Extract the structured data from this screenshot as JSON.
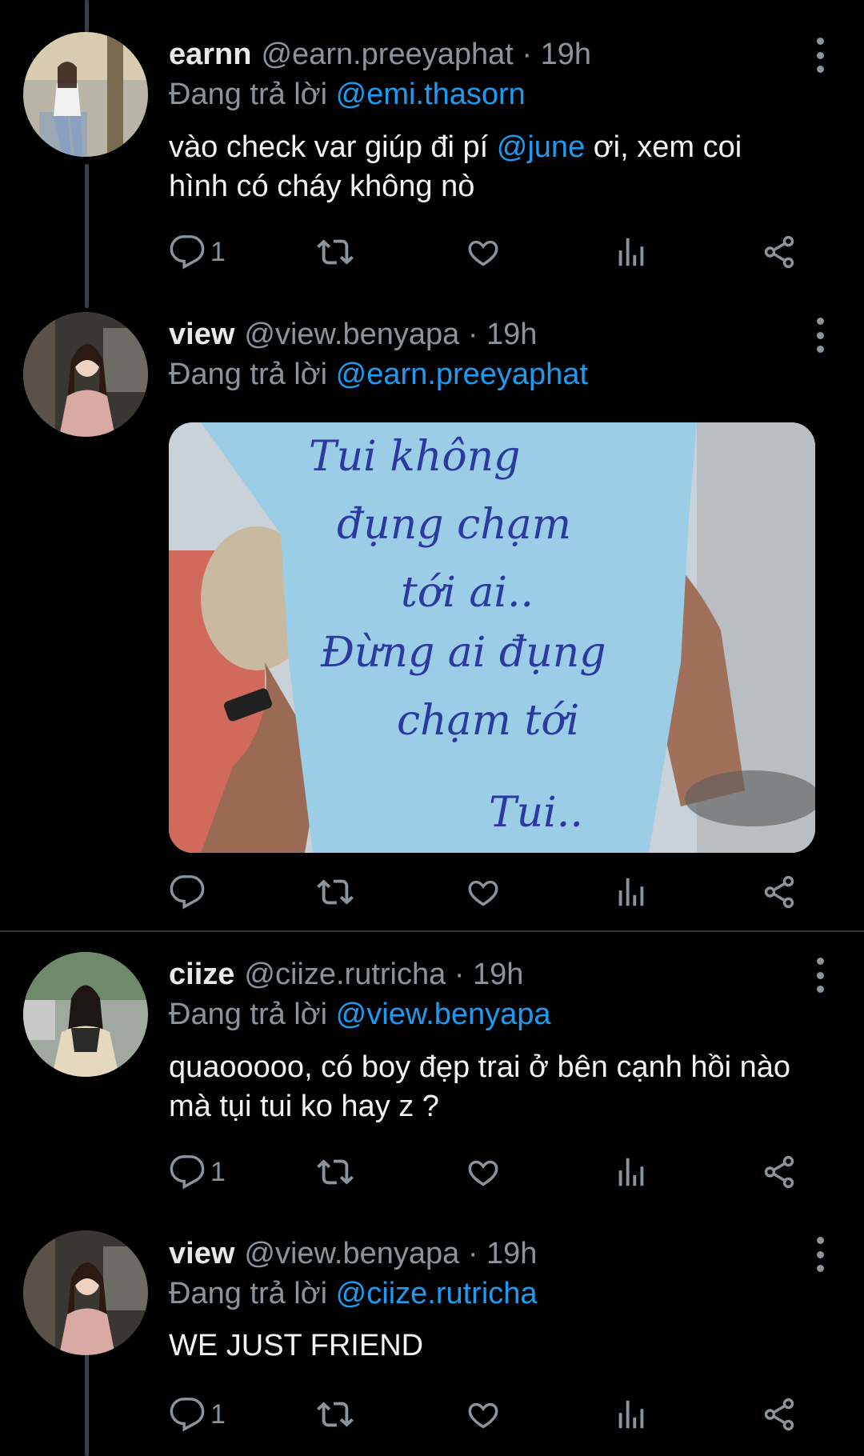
{
  "colors": {
    "background": "#000000",
    "text": "#e7e9ea",
    "secondary": "#8b939b",
    "accent": "#1d9bf0"
  },
  "tweets": [
    {
      "display_name": "earnn",
      "handle": "@earn.preeyaphat",
      "time": "· 19h",
      "replying_label": "Đang trả lời",
      "replying_to": "@emi.thasorn",
      "text_before": "vào check var giúp đi pí ",
      "text_mention": "@june",
      "text_after": " ơi, xem coi hình có cháy không nò",
      "reply_count": "1"
    },
    {
      "display_name": "view",
      "handle": "@view.benyapa",
      "time": "· 19h",
      "replying_label": "Đang trả lời",
      "replying_to": "@earn.preeyaphat",
      "media": {
        "description_icon": "photo-of-handwritten-shirt",
        "handwriting_lines": [
          "Tui không",
          "đụng chạm",
          "tới ai..",
          "Đừng ai đụng",
          "chạm tới",
          "Tui.."
        ]
      },
      "reply_count": ""
    },
    {
      "display_name": "ciize",
      "handle": "@ciize.rutricha",
      "time": "· 19h",
      "replying_label": "Đang trả lời",
      "replying_to": "@view.benyapa",
      "text": "quaooooo, có boy đẹp trai ở bên cạnh hồi nào mà tụi tui ko hay z ?",
      "reply_count": "1"
    },
    {
      "display_name": "view",
      "handle": "@view.benyapa",
      "time": "· 19h",
      "replying_label": "Đang trả lời",
      "replying_to": "@ciize.rutricha",
      "text": "WE JUST FRIEND",
      "reply_count": "1"
    }
  ],
  "icons": [
    "reply-icon",
    "retweet-icon",
    "like-icon",
    "analytics-icon",
    "share-icon",
    "more-options-icon"
  ]
}
